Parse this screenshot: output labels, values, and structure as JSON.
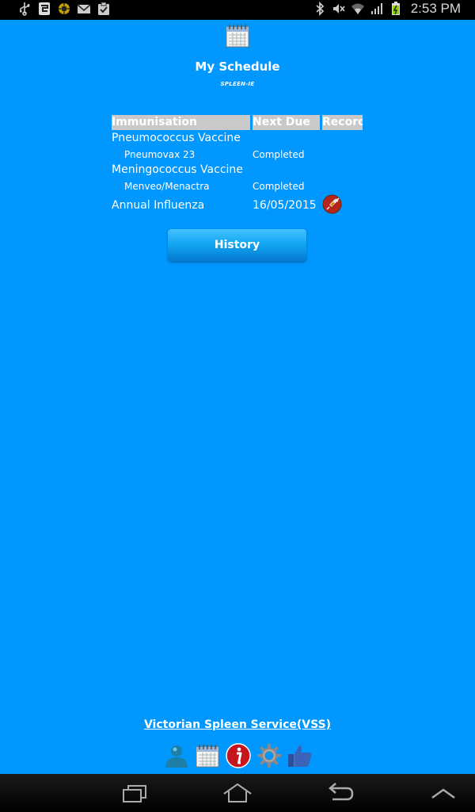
{
  "status_bar": {
    "left_icons": [
      "usb-icon",
      "sim-icon",
      "bug-icon",
      "mail-icon",
      "clipboard-icon"
    ],
    "right_icons": [
      "bluetooth-icon",
      "mute-icon",
      "wifi-icon",
      "signal-icon",
      "battery-icon"
    ],
    "time": "2:53 PM"
  },
  "header": {
    "icon": "calendar-icon",
    "title": "My Schedule",
    "subtitle": "SPLEEN-IE"
  },
  "table": {
    "columns": [
      "Immunisation",
      "Next Due",
      "Record"
    ],
    "rows": [
      {
        "vaccine": "Pneumococcus Vaccine",
        "brand": "Pneumovax 23",
        "status": "Completed"
      },
      {
        "vaccine": "Meningococcus Vaccine",
        "brand": "Menveo/Menactra",
        "status": "Completed"
      },
      {
        "vaccine": "Annual Influenza",
        "next_due": "16/05/2015",
        "record_icon": "syringe-icon"
      }
    ]
  },
  "history_button": "History",
  "footer": {
    "link": "Victorian Spleen Service(VSS)",
    "icons": [
      "profile-icon",
      "calendar-icon",
      "info-icon",
      "settings-gear-icon",
      "like-thumbs-up-icon"
    ]
  },
  "nav_bar": {
    "buttons": [
      "recent-apps-icon",
      "home-icon",
      "back-icon",
      "menu-up-icon"
    ]
  },
  "colors": {
    "app_background": "#0097FF",
    "header_cell": "#C9C9C9",
    "button_top": "#43C2FF",
    "button_bottom": "#0478CF"
  }
}
